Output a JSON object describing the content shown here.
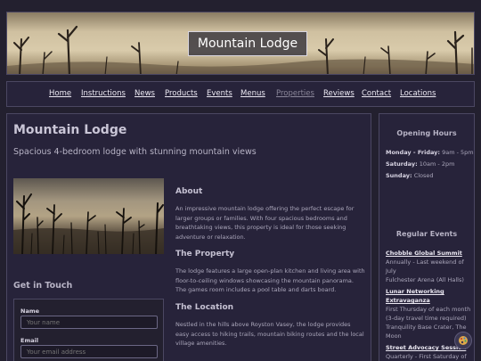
{
  "site": {
    "banner_title": "Mountain Lodge"
  },
  "nav": {
    "items": [
      {
        "label": "Home"
      },
      {
        "label": "Instructions"
      },
      {
        "label": "News"
      },
      {
        "label": "Products"
      },
      {
        "label": "Events"
      },
      {
        "label": "Menus"
      },
      {
        "label": "Properties"
      },
      {
        "label": "Reviews"
      },
      {
        "label": "Contact"
      },
      {
        "label": "Locations"
      }
    ]
  },
  "main": {
    "title": "Mountain Lodge",
    "subtitle": "Spacious 4-bedroom lodge with stunning mountain views",
    "sections": [
      {
        "heading": "About",
        "body": "An impressive mountain lodge offering the perfect escape for larger groups or families. With four spacious bedrooms and breathtaking views, this property is ideal for those seeking adventure or relaxation."
      },
      {
        "heading": "The Property",
        "body": "The lodge features a large open-plan kitchen and living area with floor-to-ceiling windows showcasing the mountain panorama. The games room includes a pool table and darts board."
      },
      {
        "heading": "The Location",
        "body": "Nestled in the hills above Royston Vasey, the lodge provides easy access to hiking trails, mountain biking routes and the local village amenities."
      }
    ],
    "contact": {
      "heading": "Get in Touch",
      "name_label": "Name",
      "name_placeholder": "Your name",
      "email_label": "Email",
      "email_placeholder": "Your email address"
    }
  },
  "sidebar": {
    "hours_heading": "Opening Hours",
    "hours": [
      {
        "days": "Monday - Friday:",
        "time": "9am - 5pm"
      },
      {
        "days": "Saturday:",
        "time": "10am - 2pm"
      },
      {
        "days": "Sunday:",
        "time": "Closed"
      }
    ],
    "events_heading": "Regular Events",
    "events": [
      {
        "title": "Chobble Global Summit",
        "when": "Annually - Last weekend of July",
        "where": "Fulchester Arena (All Halls)"
      },
      {
        "title": "Lunar Networking Extravaganza",
        "when": "First Thursday of each month (3-day travel time required)",
        "where": "Tranquility Base Crater, The Moon"
      },
      {
        "title": "Street Advocacy Session",
        "when": "Quarterly - First Saturday of",
        "where": ""
      }
    ]
  },
  "icons": {
    "fab": "palette-icon"
  },
  "colors": {
    "background": "#23202f",
    "panel": "#27233a",
    "border": "#4b4762",
    "text": "#b8b4c4"
  }
}
